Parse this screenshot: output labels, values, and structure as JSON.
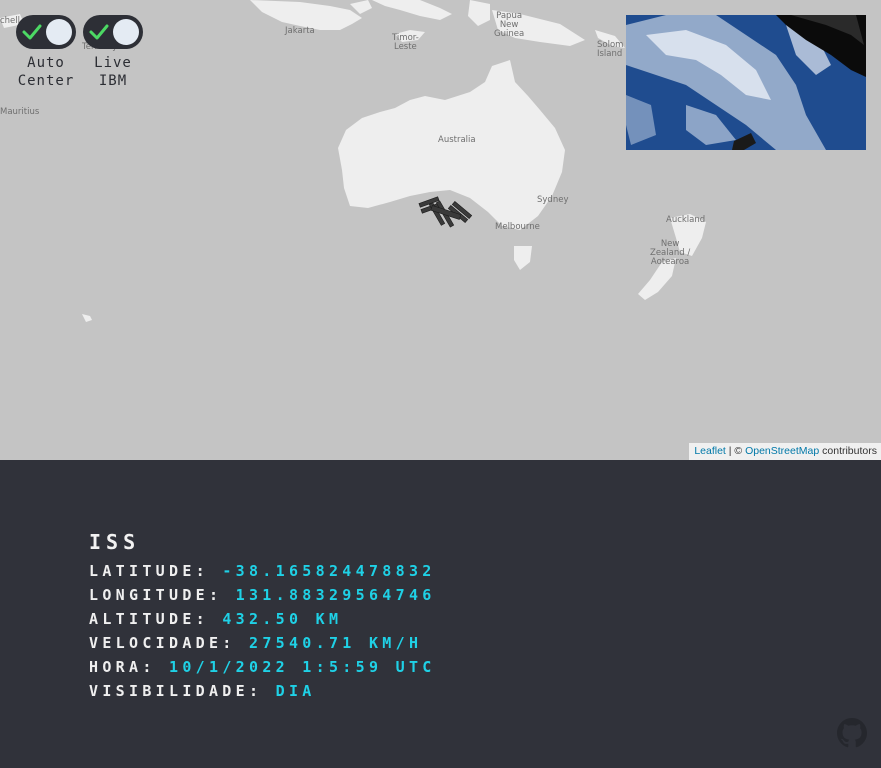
{
  "map": {
    "labels": {
      "jakarta": "Jakarta",
      "timor_leste": "Timor-\nLeste",
      "papua_new_guinea": "Papua\nNew\nGuinea",
      "solomon": "Solom\nIsland",
      "australia": "Australia",
      "sydney": "Sydney",
      "melbourne": "Melbourne",
      "auckland": "Auckland",
      "new_zealand": "New\nZealand /\nAotearoa",
      "mauritius": "Mauritius",
      "seychelles": "chell",
      "territory": "Territory"
    },
    "attribution": {
      "leaflet": "Leaflet",
      "separator": " | © ",
      "osm": "OpenStreetMap",
      "suffix": " contributors"
    }
  },
  "controls": {
    "auto_center": {
      "label": "Auto\nCenter",
      "checked": true
    },
    "live_ibm": {
      "label": "Live\nIBM",
      "checked": true
    }
  },
  "iss": {
    "title": "ISS",
    "latitude": {
      "label": "LATITUDE: ",
      "value": "-38.165824478832"
    },
    "longitude": {
      "label": "LONGITUDE: ",
      "value": "131.88329564746"
    },
    "altitude": {
      "label": "ALTITUDE: ",
      "value": "432.50 KM"
    },
    "velocity": {
      "label": "VELOCIDADE: ",
      "value": "27540.71 KM/H"
    },
    "time": {
      "label": "HORA: ",
      "value": "10/1/2022 1:5:59 UTC"
    },
    "visibility": {
      "label": "VISIBILIDADE: ",
      "value": "DIA"
    }
  },
  "colors": {
    "map_water": "#c4c4c4",
    "map_land": "#eeeeee",
    "panel_bg": "#30323a",
    "accent": "#1fd1e6"
  },
  "icons": {
    "check": "check-icon",
    "github": "github-icon",
    "iss": "iss-station-icon"
  }
}
